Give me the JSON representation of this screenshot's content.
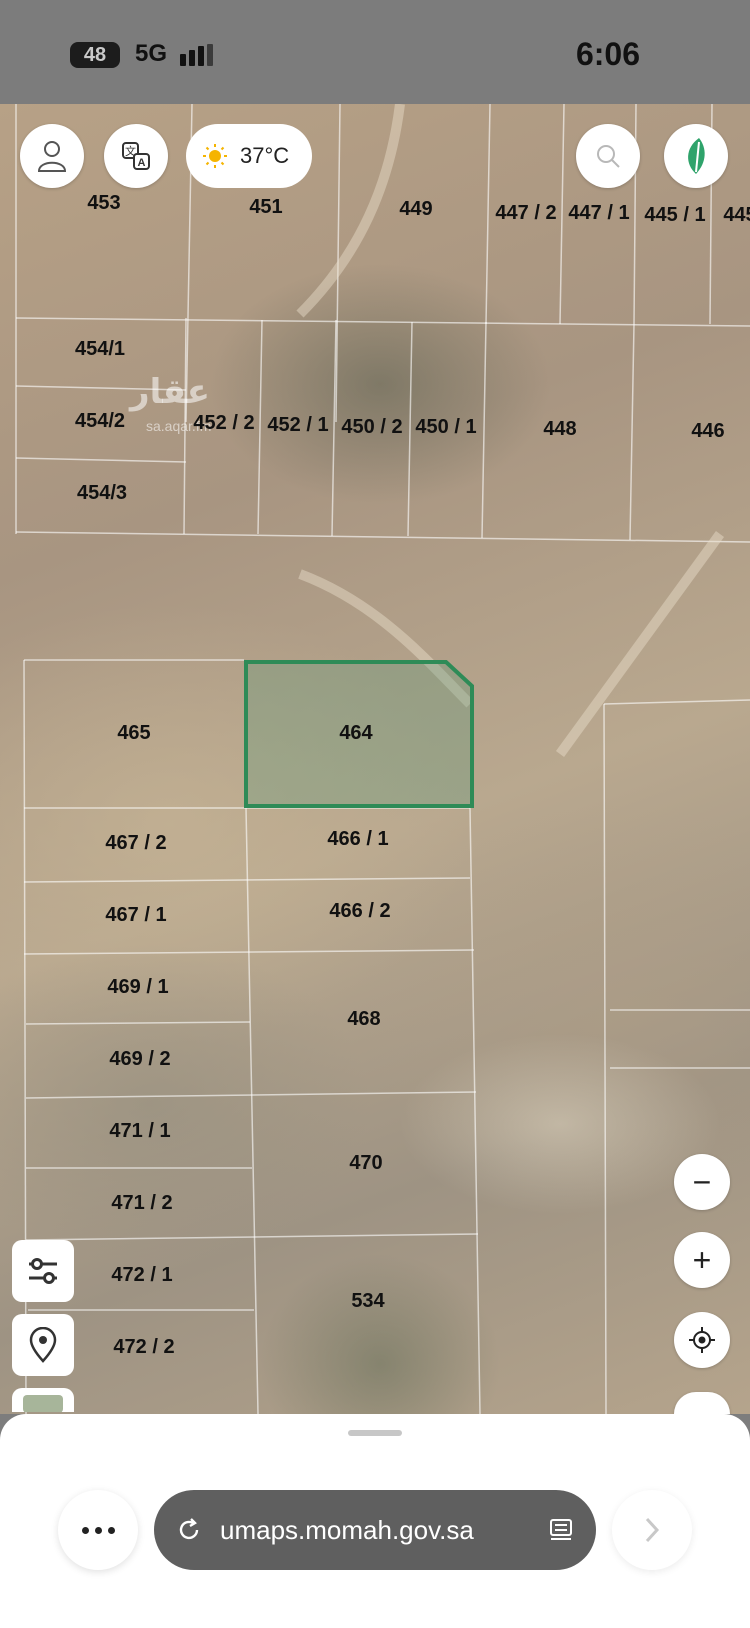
{
  "status_bar": {
    "battery": "48",
    "network": "5G",
    "time": "6:06"
  },
  "weather": {
    "temperature": "37°C",
    "icon": "sun-icon"
  },
  "top_controls": {
    "profile_icon": "user-icon",
    "translate_icon": "translate-icon",
    "search_icon": "search-icon",
    "logo_icon": "brand-leaf-icon"
  },
  "map": {
    "watermark": "عقار",
    "watermark_sub": "sa.aqar.fm",
    "selected_parcel": "464",
    "selected_color": "#2e8b57",
    "parcels": [
      "453",
      "451",
      "449",
      "447 / 2",
      "447 / 1",
      "445 / 1",
      "445",
      "454/1",
      "454/2",
      "452 / 2",
      "452 / 1",
      "450 / 2",
      "450 / 1",
      "448",
      "446",
      "454/3",
      "465",
      "464",
      "467 / 2",
      "466 / 1",
      "467 / 1",
      "466 / 2",
      "469 / 1",
      "468",
      "469 / 2",
      "471 / 1",
      "470",
      "471 / 2",
      "472 / 1",
      "534",
      "472 / 2"
    ]
  },
  "side_controls": {
    "zoom_out": "−",
    "zoom_in": "+",
    "locate_icon": "crosshair-icon",
    "filter_icon": "sliders-icon",
    "pin_icon": "location-pin-icon",
    "layers_icon": "map-layers-icon"
  },
  "browser": {
    "url": "umaps.momah.gov.sa",
    "reload_icon": "reload-icon",
    "reader_icon": "reader-icon",
    "more_icon": "more-icon",
    "forward_icon": "chevron-right-icon"
  }
}
